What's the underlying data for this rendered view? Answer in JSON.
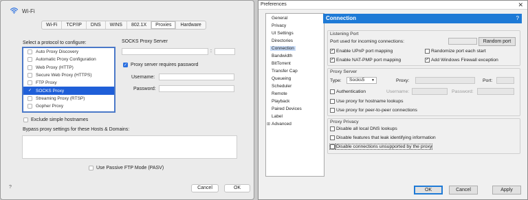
{
  "mac": {
    "window_title": "Wi-Fi",
    "tabs": [
      "Wi-Fi",
      "TCP/IP",
      "DNS",
      "WINS",
      "802.1X",
      "Proxies",
      "Hardware"
    ],
    "active_tab": "Proxies",
    "protocol_prompt": "Select a protocol to configure:",
    "protocols": [
      {
        "label": "Auto Proxy Discovery",
        "checked": false,
        "selected": false
      },
      {
        "label": "Automatic Proxy Configuration",
        "checked": false,
        "selected": false
      },
      {
        "label": "Web Proxy (HTTP)",
        "checked": false,
        "selected": false
      },
      {
        "label": "Secure Web Proxy (HTTPS)",
        "checked": false,
        "selected": false
      },
      {
        "label": "FTP Proxy",
        "checked": false,
        "selected": false
      },
      {
        "label": "SOCKS Proxy",
        "checked": true,
        "selected": true
      },
      {
        "label": "Streaming Proxy (RTSP)",
        "checked": false,
        "selected": false
      },
      {
        "label": "Gopher Proxy",
        "checked": false,
        "selected": false
      }
    ],
    "server_heading": "SOCKS Proxy Server",
    "server_value": "",
    "port_separator": ":",
    "port_value": "",
    "requires_password_label": "Proxy server requires password",
    "requires_password_checked": true,
    "username_label": "Username:",
    "username_value": "",
    "password_label": "Password:",
    "password_value": "",
    "exclude_label": "Exclude simple hostnames",
    "bypass_label": "Bypass proxy settings for these Hosts & Domains:",
    "bypass_value": "",
    "passive_ftp_label": "Use Passive FTP Mode (PASV)",
    "help": "?",
    "cancel": "Cancel",
    "ok": "OK"
  },
  "win": {
    "window_title": "Preferences",
    "close": "✕",
    "tree": [
      {
        "label": "General",
        "selected": false,
        "expandable": false
      },
      {
        "label": "Privacy",
        "selected": false,
        "expandable": false
      },
      {
        "label": "UI Settings",
        "selected": false,
        "expandable": false
      },
      {
        "label": "Directories",
        "selected": false,
        "expandable": false
      },
      {
        "label": "Connection",
        "selected": true,
        "expandable": false
      },
      {
        "label": "Bandwidth",
        "selected": false,
        "expandable": false
      },
      {
        "label": "BitTorrent",
        "selected": false,
        "expandable": false
      },
      {
        "label": "Transfer Cap",
        "selected": false,
        "expandable": false
      },
      {
        "label": "Queueing",
        "selected": false,
        "expandable": false
      },
      {
        "label": "Scheduler",
        "selected": false,
        "expandable": false
      },
      {
        "label": "Remote",
        "selected": false,
        "expandable": false
      },
      {
        "label": "Playback",
        "selected": false,
        "expandable": false
      },
      {
        "label": "Paired Devices",
        "selected": false,
        "expandable": false
      },
      {
        "label": "Label",
        "selected": false,
        "expandable": false
      },
      {
        "label": "Advanced",
        "selected": false,
        "expandable": true
      }
    ],
    "header": "Connection",
    "header_help": "?",
    "listening": {
      "title": "Listening Port",
      "port_label": "Port used for incoming connections:",
      "port_value": "",
      "random_port": "Random port",
      "upnp_label": "Enable UPnP port mapping",
      "upnp_checked": true,
      "randomize_label": "Randomize port each start",
      "randomize_checked": false,
      "natpmp_label": "Enable NAT-PMP port mapping",
      "natpmp_checked": true,
      "firewall_label": "Add Windows Firewall exception",
      "firewall_checked": true
    },
    "proxy": {
      "title": "Proxy Server",
      "type_label": "Type:",
      "type_value": "Socks5",
      "proxy_label": "Proxy:",
      "proxy_value": "",
      "port_label": "Port:",
      "port_value": "",
      "auth_label": "Authentication",
      "auth_checked": false,
      "username_label": "Username:",
      "password_label": "Password:",
      "hostname_label": "Use proxy for hostname lookups",
      "hostname_checked": false,
      "p2p_label": "Use proxy for peer-to-peer connections",
      "p2p_checked": false
    },
    "privacy": {
      "title": "Proxy Privacy",
      "dns_label": "Disable all local DNS lookups",
      "dns_checked": false,
      "leak_label": "Disable features that leak identifying information",
      "leak_checked": false,
      "unsupported_label": "Disable connections unsupported by the proxy",
      "unsupported_checked": false
    },
    "ok": "OK",
    "cancel": "Cancel",
    "apply": "Apply"
  },
  "colors": {
    "mac_selection": "#1f5fd8",
    "mac_list_border": "#4a78c8",
    "win_header": "#1e7ad6"
  }
}
